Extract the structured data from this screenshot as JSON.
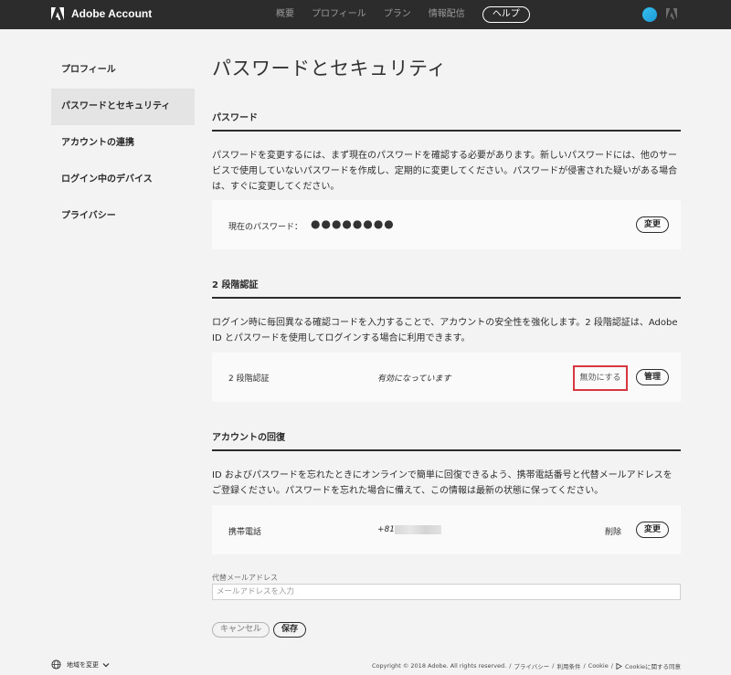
{
  "topbar": {
    "brand_name": "Adobe Account",
    "nav": [
      "概要",
      "プロフィール",
      "プラン",
      "情報配信"
    ],
    "help": "ヘルプ"
  },
  "sidebar": {
    "items": [
      {
        "label": "プロフィール",
        "active": false
      },
      {
        "label": "パスワードとセキュリティ",
        "active": true
      },
      {
        "label": "アカウントの連携",
        "active": false
      },
      {
        "label": "ログイン中のデバイス",
        "active": false
      },
      {
        "label": "プライバシー",
        "active": false
      }
    ]
  },
  "page_title": "パスワードとセキュリティ",
  "password": {
    "title": "パスワード",
    "description": "パスワードを変更するには、まず現在のパスワードを確認する必要があります。新しいパスワードには、他のサービスで使用していないパスワードを作成し、定期的に変更してください。パスワードが侵害された疑いがある場合は、すぐに変更してください。",
    "current_label": "現在のパスワード：",
    "current_value": "●●●●●●●●",
    "change_button": "変更"
  },
  "two_factor": {
    "title": "2 段階認証",
    "description": "ログイン時に毎回異なる確認コードを入力することで、アカウントの安全性を強化します。2 段階認証は、Adobe ID とパスワードを使用してログインする場合に利用できます。",
    "row_label": "2 段階認証",
    "status": "有効になっています",
    "disable_button": "無効にする",
    "manage_button": "管理"
  },
  "recovery": {
    "title": "アカウントの回復",
    "description": "ID およびパスワードを忘れたときにオンラインで簡単に回復できるよう、携帯電話番号と代替メールアドレスをご登録ください。パスワードを忘れた場合に備えて、この情報は最新の状態に保ってください。",
    "phone_label": "携帯電話",
    "phone_prefix": "+81",
    "delete_button": "削除",
    "change_button": "変更",
    "alt_email_label": "代替メールアドレス",
    "alt_email_placeholder": "メールアドレスを入力",
    "cancel_button": "キャンセル",
    "save_button": "保存"
  },
  "footer": {
    "region": "地域を変更",
    "copyright": "Copyright © 2018 Adobe. All rights reserved.",
    "links": [
      "プライバシー",
      "利用条件",
      "Cookie",
      "Cookieに関する同意"
    ]
  },
  "colors": {
    "topbar_bg": "#2c2c2c",
    "page_bg": "#f3f3f3",
    "card_bg": "#fafafa",
    "highlight_red": "#d7373f",
    "avatar_blue": "#35c0ef"
  },
  "icons": [
    "adobe-logo-icon",
    "avatar-icon",
    "adobe-mini-icon",
    "globe-icon",
    "chevron-down-icon",
    "arrow-right-icon"
  ]
}
